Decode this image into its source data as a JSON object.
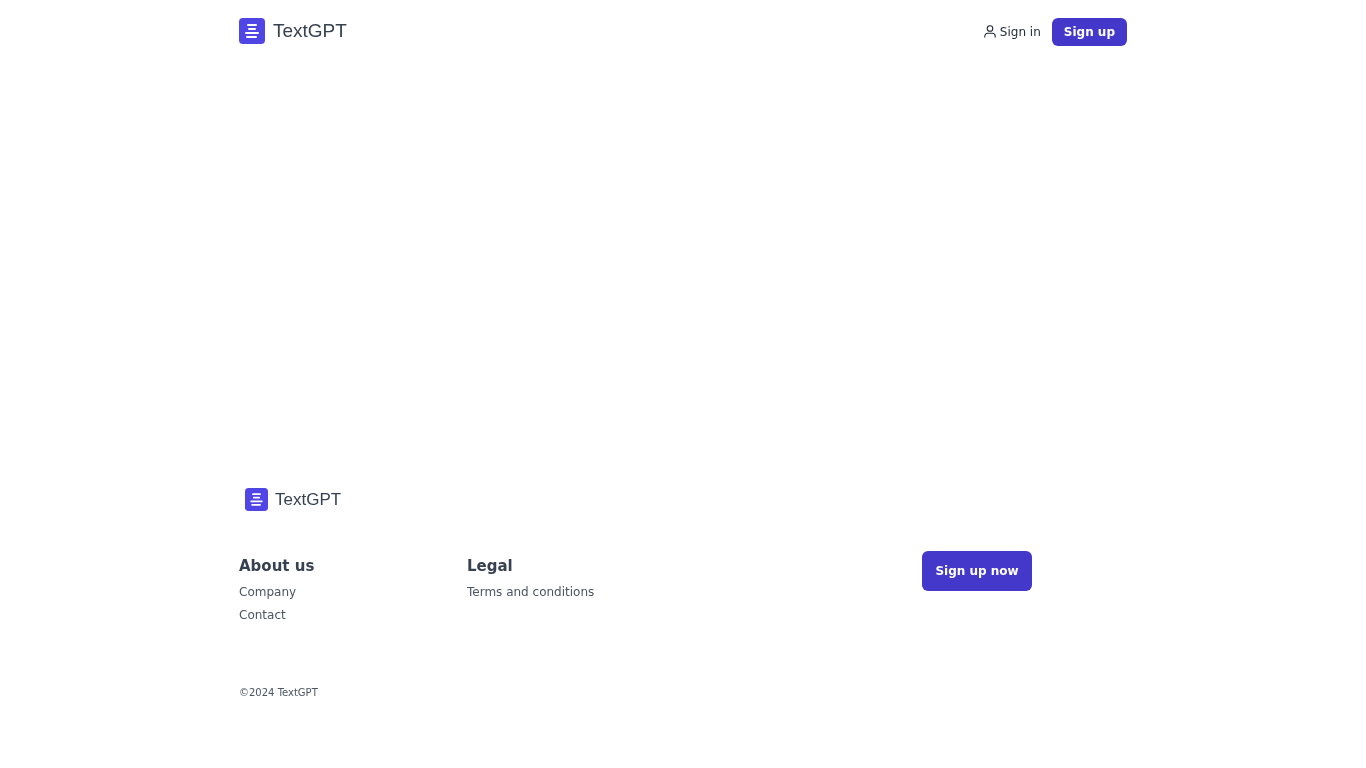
{
  "header": {
    "logo": {
      "name": "TextGPT"
    },
    "sign_in": "Sign in",
    "sign_up": "Sign up"
  },
  "footer": {
    "logo": {
      "name": "TextGPT"
    },
    "columns": [
      {
        "heading": "About us",
        "links": [
          "Company",
          "Contact"
        ]
      },
      {
        "heading": "Legal",
        "links": [
          "Terms and conditions"
        ]
      }
    ],
    "cta": "Sign up now",
    "copyright": "©2024 TextGPT"
  }
}
